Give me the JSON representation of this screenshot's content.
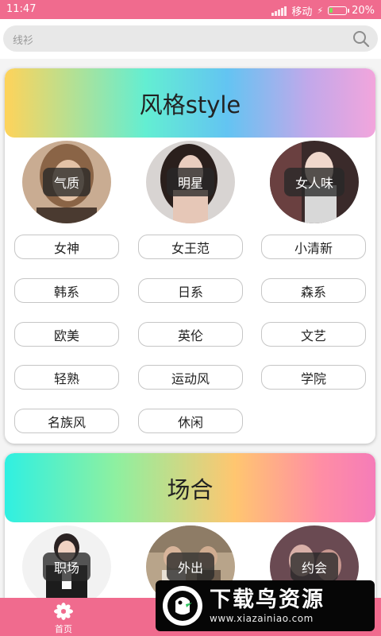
{
  "status": {
    "time": "11:47",
    "carrier": "移动",
    "battery": "20%",
    "battery_level": 0.2,
    "battery_color": "#7be05a"
  },
  "search": {
    "placeholder": "线衫",
    "icon": "search-icon"
  },
  "sections": [
    {
      "title": "风格style",
      "avatars": [
        {
          "label": "气质"
        },
        {
          "label": "明星"
        },
        {
          "label": "女人味"
        }
      ],
      "tags": [
        "女神",
        "女王范",
        "小清新",
        "韩系",
        "日系",
        "森系",
        "欧美",
        "英伦",
        "文艺",
        "轻熟",
        "运动风",
        "学院",
        "名族风",
        "休闲"
      ]
    },
    {
      "title": "场合",
      "avatars": [
        {
          "label": "职场"
        },
        {
          "label": "外出"
        },
        {
          "label": "约会"
        }
      ]
    }
  ],
  "nav": {
    "home_label": "首页",
    "home_icon": "flower-icon"
  },
  "watermark": {
    "title": "下载鸟资源",
    "url": "www.xiazainiao.com"
  },
  "colors": {
    "accent": "#f06b8e"
  }
}
